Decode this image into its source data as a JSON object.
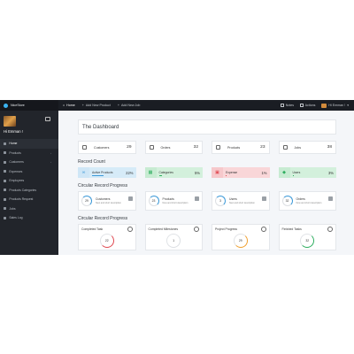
{
  "topbar": {
    "brand": "NiceStore",
    "links": [
      {
        "label": "Home",
        "active": true
      },
      {
        "label": "Add New Product",
        "active": false
      },
      {
        "label": "Add New Job",
        "active": false
      }
    ],
    "right": {
      "notes": "Notes",
      "actions": "Actions",
      "user": "Hi Emman !"
    }
  },
  "sidebar": {
    "user_name": "Hi Emman !",
    "items": [
      {
        "label": "Home",
        "icon": "home-icon",
        "active": true,
        "caret": false
      },
      {
        "label": "Products",
        "icon": "products-icon",
        "active": false,
        "caret": true
      },
      {
        "label": "Customers",
        "icon": "customers-icon",
        "active": false,
        "caret": true
      },
      {
        "label": "Expenses",
        "icon": "expenses-icon",
        "active": false,
        "caret": false
      },
      {
        "label": "Employees",
        "icon": "employees-icon",
        "active": false,
        "caret": false
      },
      {
        "label": "Products Categories",
        "icon": "categories-icon",
        "active": false,
        "caret": false
      },
      {
        "label": "Products Request",
        "icon": "request-icon",
        "active": false,
        "caret": false
      },
      {
        "label": "Jobs",
        "icon": "jobs-icon",
        "active": false,
        "caret": false
      },
      {
        "label": "Sales Log",
        "icon": "log-icon",
        "active": false,
        "caret": false
      }
    ]
  },
  "main": {
    "title": "The Dashboard",
    "stats": [
      {
        "label": "Customers",
        "value": "29",
        "icon": "customers-icon"
      },
      {
        "label": "Orders",
        "value": "32",
        "icon": "orders-icon"
      },
      {
        "label": "Products",
        "value": "23",
        "icon": "products-icon"
      },
      {
        "label": "Jobs",
        "value": "38",
        "icon": "jobs-icon"
      }
    ],
    "record_count_title": "Record Count",
    "record_counts": [
      {
        "label": "Active Products",
        "value": "22%",
        "bg": "#d6ebf8",
        "icon_bg": "#cfe6f6",
        "bar_color": "#3b99d8"
      },
      {
        "label": "Categories",
        "value": "5%",
        "bg": "#d3f0dc",
        "icon_bg": "#c7ebd2",
        "bar_color": "#2eae5f"
      },
      {
        "label": "Expense",
        "value": "1%",
        "bg": "#f9d6d8",
        "icon_bg": "#f6c8cb",
        "bar_color": "#e04a52"
      },
      {
        "label": "Users",
        "value": "3%",
        "bg": "#d3f0dc",
        "icon_bg": "#c7ebd2",
        "bar_color": "#2eae5f"
      }
    ],
    "circular_title_1": "Circular Record Progress",
    "progress": [
      {
        "label": "Customers",
        "value": "29",
        "desc": "New and short description"
      },
      {
        "label": "Products",
        "value": "23",
        "desc": "New and short description"
      },
      {
        "label": "Users",
        "value": "3",
        "desc": "New and short description"
      },
      {
        "label": "Orders",
        "value": "32",
        "desc": "New and short description"
      }
    ],
    "circular_title_2": "Circular Record Progress",
    "circles": [
      {
        "label": "Completed Task",
        "value": "22",
        "arc_color": "#e04a52"
      },
      {
        "label": "Completed Milestones",
        "value": "1",
        "arc_color": "#dcdfe3"
      },
      {
        "label": "Project Progress",
        "value": "29",
        "arc_color": "#f0a030"
      },
      {
        "label": "Finished Tasks",
        "value": "32",
        "arc_color": "#2eae5f"
      }
    ]
  }
}
